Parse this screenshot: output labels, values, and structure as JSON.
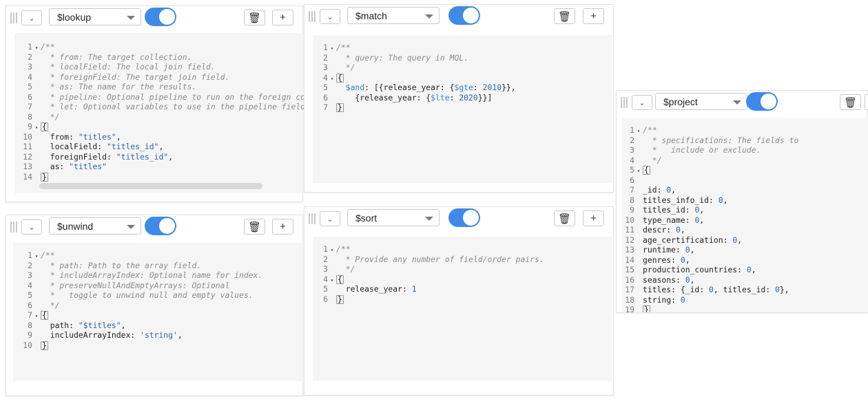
{
  "stages": {
    "lookup": {
      "operator": "$lookup",
      "lines": [
        [
          {
            "t": "/**",
            "k": "c"
          }
        ],
        [
          {
            "t": "  * from: The target collection.",
            "k": "c"
          }
        ],
        [
          {
            "t": "  * localField: The local join field.",
            "k": "c"
          }
        ],
        [
          {
            "t": "  * foreignField: The target join field.",
            "k": "c"
          }
        ],
        [
          {
            "t": "  * as: The name for the results.",
            "k": "c"
          }
        ],
        [
          {
            "t": "  * pipeline: Optional pipeline to run on the foreign co",
            "k": "c"
          }
        ],
        [
          {
            "t": "  * let: Optional variables to use in the pipeline field",
            "k": "c"
          }
        ],
        [
          {
            "t": "  */",
            "k": "c"
          }
        ],
        [
          {
            "t": "{",
            "k": "b"
          }
        ],
        [
          {
            "t": "  from: ",
            "k": ""
          },
          {
            "t": "\"titles\"",
            "k": "s"
          },
          {
            "t": ",",
            "k": ""
          }
        ],
        [
          {
            "t": "  localField: ",
            "k": ""
          },
          {
            "t": "\"titles_id\"",
            "k": "s"
          },
          {
            "t": ",",
            "k": ""
          }
        ],
        [
          {
            "t": "  foreignField: ",
            "k": ""
          },
          {
            "t": "\"titles_id\"",
            "k": "s"
          },
          {
            "t": ",",
            "k": ""
          }
        ],
        [
          {
            "t": "  as: ",
            "k": ""
          },
          {
            "t": "\"titles\"",
            "k": "s"
          }
        ],
        [
          {
            "t": "}",
            "k": "b"
          }
        ]
      ]
    },
    "match": {
      "operator": "$match",
      "lines": [
        [
          {
            "t": "/**",
            "k": "c"
          }
        ],
        [
          {
            "t": "  * query: The query in MQL.",
            "k": "c"
          }
        ],
        [
          {
            "t": "  */",
            "k": "c"
          }
        ],
        [
          {
            "t": "{",
            "k": "b"
          }
        ],
        [
          {
            "t": "  ",
            "k": ""
          },
          {
            "t": "$and",
            "k": "op"
          },
          {
            "t": ": [{release_year: {",
            "k": ""
          },
          {
            "t": "$gte",
            "k": "op"
          },
          {
            "t": ": ",
            "k": ""
          },
          {
            "t": "2010",
            "k": "n"
          },
          {
            "t": "}},",
            "k": ""
          }
        ],
        [
          {
            "t": "    {release_year: {",
            "k": ""
          },
          {
            "t": "$lte",
            "k": "op"
          },
          {
            "t": ": ",
            "k": ""
          },
          {
            "t": "2020",
            "k": "n"
          },
          {
            "t": "}}]",
            "k": ""
          }
        ],
        [
          {
            "t": "}",
            "k": "b"
          }
        ]
      ]
    },
    "project": {
      "operator": "$project",
      "lines": [
        [
          {
            "t": "/**",
            "k": "c"
          }
        ],
        [
          {
            "t": "  * specifications: The fields to",
            "k": "c"
          }
        ],
        [
          {
            "t": "  *   include or exclude.",
            "k": "c"
          }
        ],
        [
          {
            "t": "  */",
            "k": "c"
          }
        ],
        [
          {
            "t": "{",
            "k": "b"
          }
        ],
        [
          {
            "t": "",
            "k": ""
          }
        ],
        [
          {
            "t": "_id: ",
            "k": ""
          },
          {
            "t": "0",
            "k": "n"
          },
          {
            "t": ",",
            "k": ""
          }
        ],
        [
          {
            "t": "titles_info_id: ",
            "k": ""
          },
          {
            "t": "0",
            "k": "n"
          },
          {
            "t": ",",
            "k": ""
          }
        ],
        [
          {
            "t": "titles_id: ",
            "k": ""
          },
          {
            "t": "0",
            "k": "n"
          },
          {
            "t": ",",
            "k": ""
          }
        ],
        [
          {
            "t": "type_name: ",
            "k": ""
          },
          {
            "t": "0",
            "k": "n"
          },
          {
            "t": ",",
            "k": ""
          }
        ],
        [
          {
            "t": "descr: ",
            "k": ""
          },
          {
            "t": "0",
            "k": "n"
          },
          {
            "t": ",",
            "k": ""
          }
        ],
        [
          {
            "t": "age_certification: ",
            "k": ""
          },
          {
            "t": "0",
            "k": "n"
          },
          {
            "t": ",",
            "k": ""
          }
        ],
        [
          {
            "t": "runtime: ",
            "k": ""
          },
          {
            "t": "0",
            "k": "n"
          },
          {
            "t": ",",
            "k": ""
          }
        ],
        [
          {
            "t": "genres: ",
            "k": ""
          },
          {
            "t": "0",
            "k": "n"
          },
          {
            "t": ",",
            "k": ""
          }
        ],
        [
          {
            "t": "production_countries: ",
            "k": ""
          },
          {
            "t": "0",
            "k": "n"
          },
          {
            "t": ",",
            "k": ""
          }
        ],
        [
          {
            "t": "seasons: ",
            "k": ""
          },
          {
            "t": "0",
            "k": "n"
          },
          {
            "t": ",",
            "k": ""
          }
        ],
        [
          {
            "t": "titles: {_id: ",
            "k": ""
          },
          {
            "t": "0",
            "k": "n"
          },
          {
            "t": ", titles_id: ",
            "k": ""
          },
          {
            "t": "0",
            "k": "n"
          },
          {
            "t": "},",
            "k": ""
          }
        ],
        [
          {
            "t": "string: ",
            "k": ""
          },
          {
            "t": "0",
            "k": "n"
          }
        ],
        [
          {
            "t": "}",
            "k": "b"
          }
        ]
      ]
    },
    "unwind": {
      "operator": "$unwind",
      "lines": [
        [
          {
            "t": "/**",
            "k": "c"
          }
        ],
        [
          {
            "t": "  * path: Path to the array field.",
            "k": "c"
          }
        ],
        [
          {
            "t": "  * includeArrayIndex: Optional name for index.",
            "k": "c"
          }
        ],
        [
          {
            "t": "  * preserveNullAndEmptyArrays: Optional",
            "k": "c"
          }
        ],
        [
          {
            "t": "  *   toggle to unwind null and empty values.",
            "k": "c"
          }
        ],
        [
          {
            "t": "  */",
            "k": "c"
          }
        ],
        [
          {
            "t": "{",
            "k": "b"
          }
        ],
        [
          {
            "t": "  path: ",
            "k": ""
          },
          {
            "t": "\"$titles\"",
            "k": "s"
          },
          {
            "t": ",",
            "k": ""
          }
        ],
        [
          {
            "t": "  includeArrayIndex: ",
            "k": ""
          },
          {
            "t": "'string'",
            "k": "s"
          },
          {
            "t": ",",
            "k": ""
          }
        ],
        [
          {
            "t": "}",
            "k": "b"
          }
        ]
      ]
    },
    "sort": {
      "operator": "$sort",
      "lines": [
        [
          {
            "t": "/**",
            "k": "c"
          }
        ],
        [
          {
            "t": "  * Provide any number of field/order pairs.",
            "k": "c"
          }
        ],
        [
          {
            "t": "  */",
            "k": "c"
          }
        ],
        [
          {
            "t": "{",
            "k": "b"
          }
        ],
        [
          {
            "t": "  release_year: ",
            "k": ""
          },
          {
            "t": "1",
            "k": "n"
          }
        ],
        [
          {
            "t": "}",
            "k": "b"
          }
        ]
      ]
    }
  },
  "folds": {
    "lookup": [
      1,
      9
    ],
    "match": [
      1,
      4
    ],
    "project": [
      1,
      5
    ],
    "unwind": [
      1,
      7
    ],
    "sort": [
      1,
      4
    ]
  },
  "icons": {
    "grip": "drag-handle-icon",
    "collapse": "chevron-down-icon",
    "delete": "trash-icon",
    "add": "plus-icon"
  },
  "colors": {
    "toggle_on": "#3f8ae8",
    "editor_bg": "#f5f5f5",
    "comment": "#8c8c8c",
    "string": "#2b66a8"
  }
}
